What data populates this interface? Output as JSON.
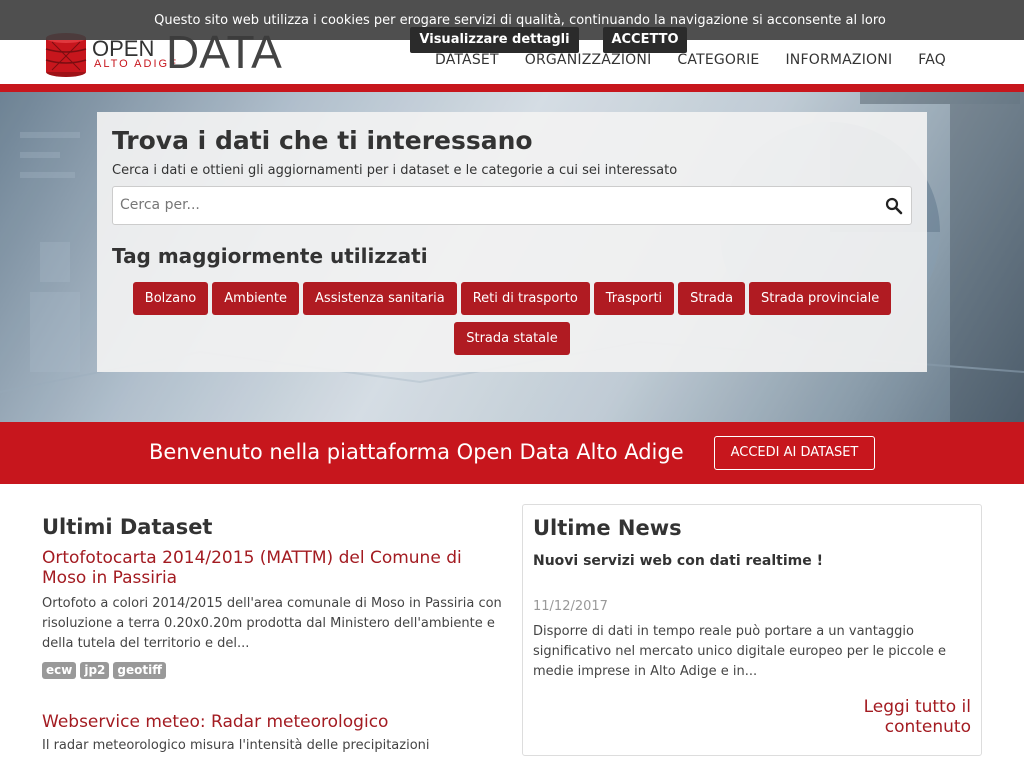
{
  "header": {
    "logo_open": "OPEN",
    "logo_data": "DATA",
    "logo_sub": "ALTO ADIGE",
    "nav": [
      "DATASET",
      "ORGANIZZAZIONI",
      "CATEGORIE",
      "INFORMAZIONI",
      "FAQ"
    ]
  },
  "cookie": {
    "text": "Questo sito web utilizza i cookies per erogare servizi di qualità, continuando la navigazione si acconsente al loro utilizzo",
    "details_label": "Visualizzare dettagli",
    "accept_label": "ACCETTO"
  },
  "hero": {
    "title": "Trova i dati che ti interessano",
    "subtitle": "Cerca i dati e ottieni gli aggiornamenti per i dataset e le categorie a cui sei interessato",
    "search_placeholder": "Cerca per...",
    "tags_title": "Tag maggiormente utilizzati",
    "tags": [
      "Bolzano",
      "Ambiente",
      "Assistenza sanitaria",
      "Reti di trasporto",
      "Trasporti",
      "Strada",
      "Strada provinciale",
      "Strada statale"
    ]
  },
  "welcome": {
    "text": "Benvenuto nella piattaforma Open Data Alto Adige",
    "button": "ACCEDI AI DATASET"
  },
  "datasets": {
    "title": "Ultimi Dataset",
    "items": [
      {
        "title": "Ortofotocarta 2014/2015 (MATTM) del Comune di Moso in Passiria",
        "description": "Ortofoto a colori 2014/2015 dell'area comunale di Moso in Passiria con risoluzione a terra 0.20x0.20m prodotta dal Ministero dell'ambiente e della tutela del territorio e del...",
        "formats": [
          "ecw",
          "jp2",
          "geotiff"
        ]
      },
      {
        "title": "Webservice meteo: Radar meteorologico",
        "description": "Il radar meteorologico misura l'intensità delle precipitazioni"
      }
    ]
  },
  "news": {
    "title": "Ultime News",
    "headline": "Nuovi servizi web con dati realtime !",
    "date": "11/12/2017",
    "body": "Disporre di dati in tempo reale può portare a un vantaggio significativo nel mercato unico digitale europeo per le piccole e medie imprese in Alto Adige e in...",
    "more": "Leggi tutto il contenuto"
  },
  "colors": {
    "brand_red": "#c7161d",
    "tag_red": "#b01b22",
    "link_red": "#a31b21"
  }
}
